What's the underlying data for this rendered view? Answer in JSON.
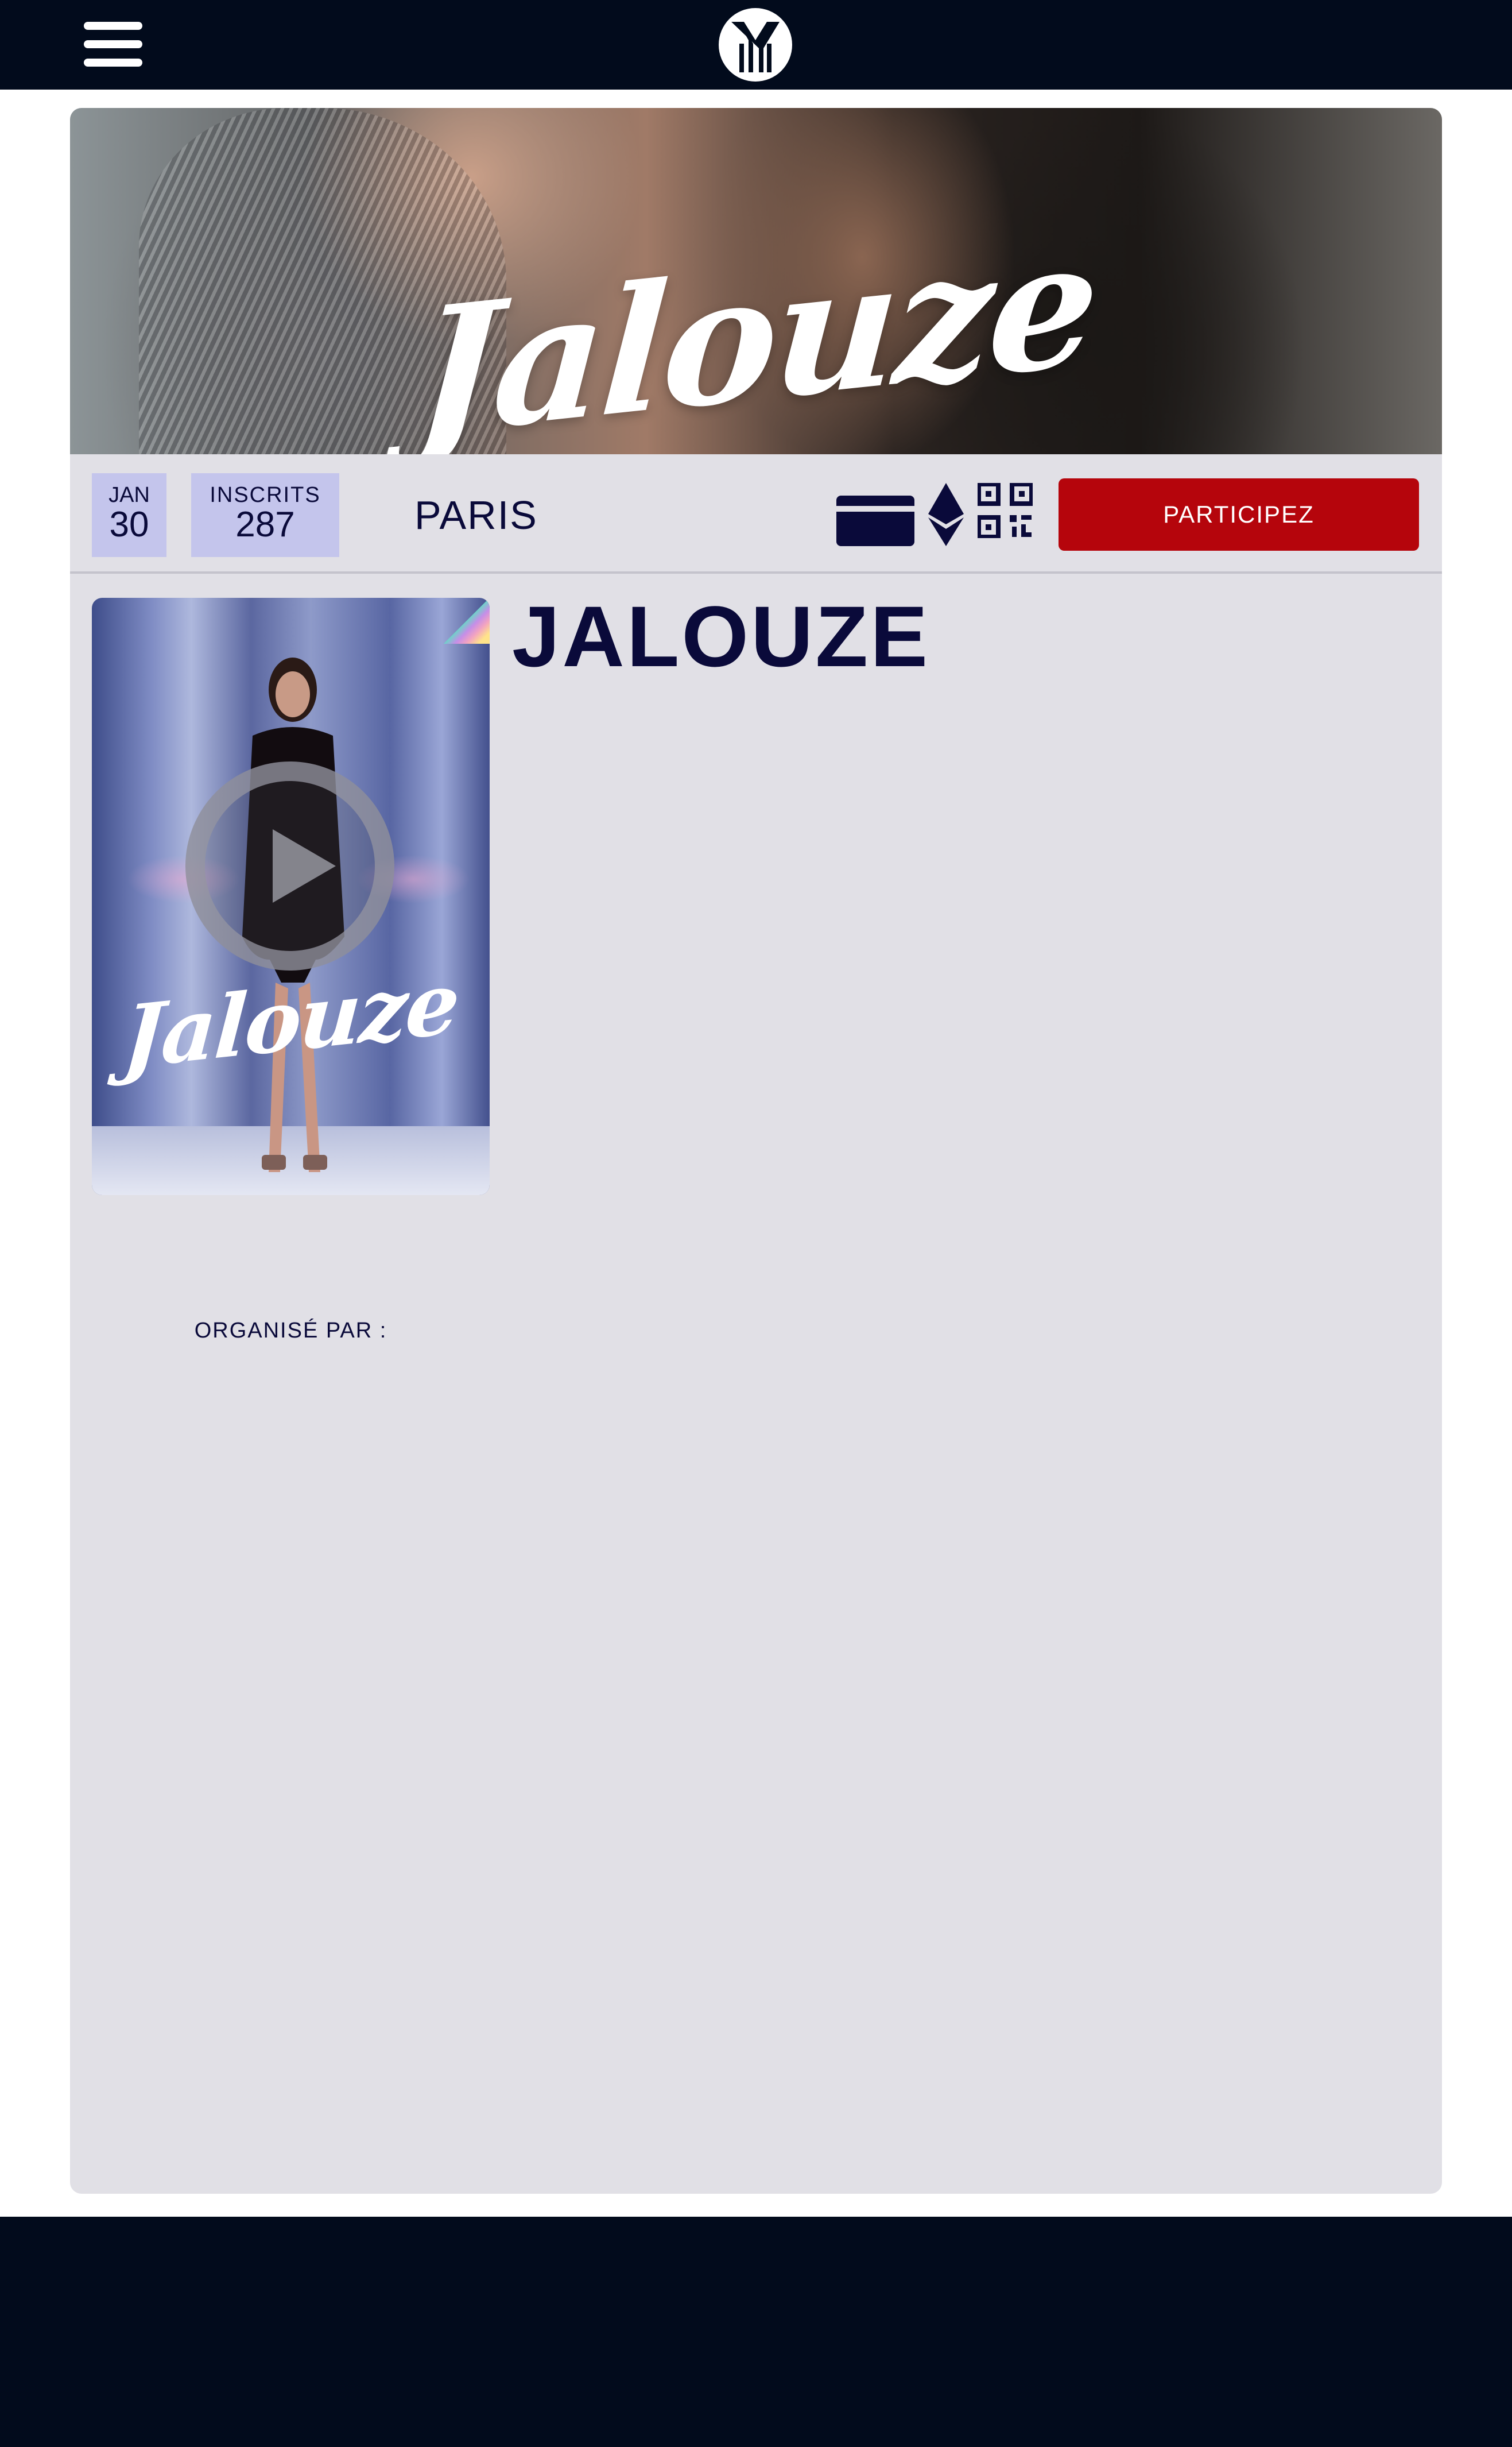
{
  "header": {
    "menu_icon": "hamburger-menu-icon",
    "logo_icon": "brand-logo-icon"
  },
  "banner": {
    "title": "Jalouze"
  },
  "event": {
    "date_month": "JAN",
    "date_day": "30",
    "registered_label": "INSCRITS",
    "registered_count": "287",
    "city": "PARIS",
    "payment_icons": [
      "credit-card-icon",
      "ethereum-icon",
      "qr-code-icon"
    ],
    "cta_label": "PARTICIPEZ",
    "title": "JALOUZE",
    "organized_by_label": "ORGANISÉ PAR  :"
  },
  "poster": {
    "title": "Jalouze",
    "play_icon": "play-icon"
  },
  "colors": {
    "topbar": "#020b1c",
    "card_bg": "#e1e0e6",
    "badge_bg": "#c4c5ec",
    "text_dark": "#0a0a3a",
    "cta": "#b5050c"
  }
}
